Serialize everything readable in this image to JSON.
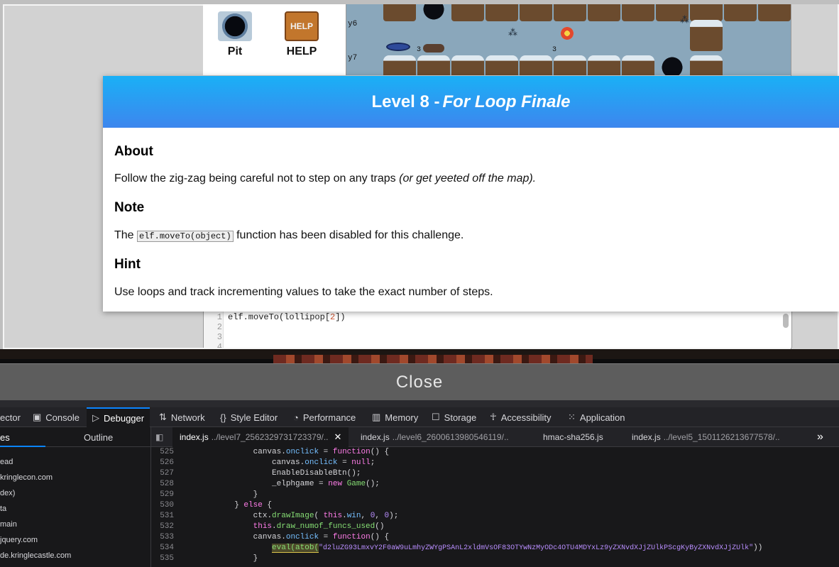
{
  "game": {
    "tools": [
      {
        "label": "Pit",
        "icon": "pit-icon"
      },
      {
        "label": "HELP",
        "icon": "help-sign-icon",
        "thumb_text": "HELP"
      }
    ],
    "rows": [
      "y6",
      "y7"
    ],
    "counts": [
      "3",
      "3"
    ],
    "editor": {
      "lines": [
        "1",
        "2",
        "3",
        "4"
      ],
      "code_parts": [
        "elf.moveTo(lollipop[",
        "2",
        "])"
      ]
    }
  },
  "modal": {
    "title_prefix": "Level 8 -",
    "title_emph": "For Loop Finale",
    "about_heading": "About",
    "about_text": "Follow the zig-zag being careful not to step on any traps",
    "about_emph": "(or get yeeted off the map).",
    "note_heading": "Note",
    "note_pre": "The",
    "note_code": "elf.moveTo(object)",
    "note_post": "function has been disabled for this challenge.",
    "hint_heading": "Hint",
    "hint_text": "Use loops and track incrementing values to take the exact number of steps."
  },
  "close_label": "Close",
  "devtools": {
    "tabs": [
      "ector",
      "Console",
      "Debugger",
      "Network",
      "Style Editor",
      "Performance",
      "Memory",
      "Storage",
      "Accessibility",
      "Application"
    ],
    "left_tabs": [
      "es",
      "Outline"
    ],
    "tree": [
      "ead",
      "kringlecon.com",
      "dex)",
      "ta",
      "main",
      "jquery.com",
      "de.kringlecastle.com"
    ],
    "source_tabs": [
      {
        "name": "index.js",
        "path": "../level7_2562329731723379/.."
      },
      {
        "name": "index.js",
        "path": "../level6_2600613980546119/.."
      },
      {
        "name": "hmac-sha256.js",
        "path": ""
      },
      {
        "name": "index.js",
        "path": "../level5_1501126213677578/.."
      }
    ],
    "line_numbers": [
      "525",
      "526",
      "527",
      "528",
      "529",
      "530",
      "531",
      "532",
      "533",
      "534",
      "535"
    ],
    "code": {
      "l525": [
        "canvas",
        ".",
        "onclick",
        " = ",
        "function",
        "() {"
      ],
      "l526": [
        "canvas",
        ".",
        "onclick",
        " = ",
        "null",
        ";"
      ],
      "l527": [
        "EnableDisableBtn",
        "();"
      ],
      "l528": [
        "_elphgame",
        " = ",
        "new",
        " ",
        "Game",
        "();"
      ],
      "l529": [
        "}"
      ],
      "l530": [
        "} ",
        "else",
        " {"
      ],
      "l531": [
        "ctx",
        ".",
        "drawImage",
        "( ",
        "this",
        ".",
        "win",
        ", ",
        "0",
        ", ",
        "0",
        ");"
      ],
      "l532": [
        "this",
        ".",
        "draw_numof_funcs_used",
        "()"
      ],
      "l533": [
        "canvas",
        ".",
        "onclick",
        " = ",
        "function",
        "() {"
      ],
      "l534": [
        "eval(atob(",
        "\"d2luZG93LmxvY2F0aW9uLmhyZWYgPSAnL2xldmVsOF83OTYwNzMyODc4OTU4MDYxLz9yZXNvdXJjZUlkPScgKyByZXNvdXJjZUlk\"",
        "))"
      ],
      "l535": [
        "}"
      ]
    }
  }
}
